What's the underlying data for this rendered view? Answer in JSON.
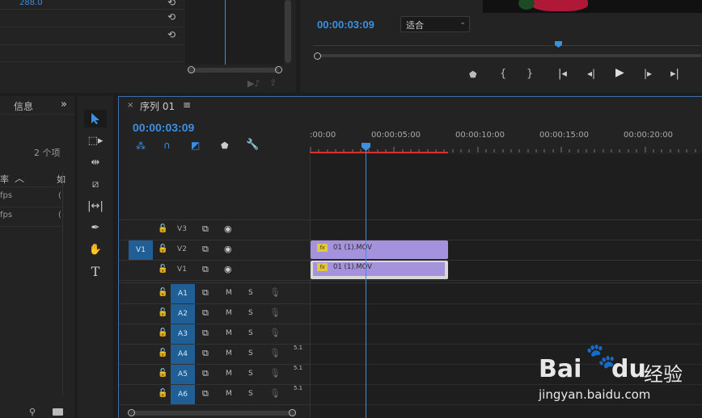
{
  "effect_controls": {
    "value": "288.0"
  },
  "program_monitor": {
    "timecode": "00:00:03:09",
    "fit_select": "适合"
  },
  "project_panel": {
    "tab_info": "信息",
    "item_count": "2 个项",
    "column_rate": "率",
    "column_other": "如",
    "rows": [
      {
        "rate": "fps",
        "extra": "("
      },
      {
        "rate": "fps",
        "extra": "("
      }
    ]
  },
  "timeline": {
    "close_glyph": "×",
    "sequence_name": "序列 01",
    "timecode": "00:00:03:09",
    "ruler_labels": [
      ":00:00",
      "00:00:05:00",
      "00:00:10:00",
      "00:00:15:00",
      "00:00:20:00"
    ],
    "video_tracks": [
      {
        "name": "V3",
        "source": ""
      },
      {
        "name": "V2",
        "source": "V1"
      },
      {
        "name": "V1",
        "source": ""
      }
    ],
    "audio_tracks": [
      {
        "name": "A1",
        "m": "M",
        "s": "S",
        "extra": ""
      },
      {
        "name": "A2",
        "m": "M",
        "s": "S",
        "extra": ""
      },
      {
        "name": "A3",
        "m": "M",
        "s": "S",
        "extra": ""
      },
      {
        "name": "A4",
        "m": "M",
        "s": "S",
        "extra": "5.1"
      },
      {
        "name": "A5",
        "m": "M",
        "s": "S",
        "extra": "5.1"
      },
      {
        "name": "A6",
        "m": "M",
        "s": "S",
        "extra": "5.1"
      }
    ],
    "clips": [
      {
        "fx": "fx",
        "name": "01 (1).MOV"
      },
      {
        "fx": "fx",
        "name": "01 (1).MOV"
      }
    ],
    "colors": {
      "accent": "#3d8fe0",
      "clip": "#a592dc",
      "render_bar": "#d63030",
      "track_blue": "#1f5f96"
    }
  },
  "watermark": {
    "brand": "Bai",
    "brand2": "du",
    "suffix": "经验",
    "url": "jingyan.baidu.com"
  }
}
